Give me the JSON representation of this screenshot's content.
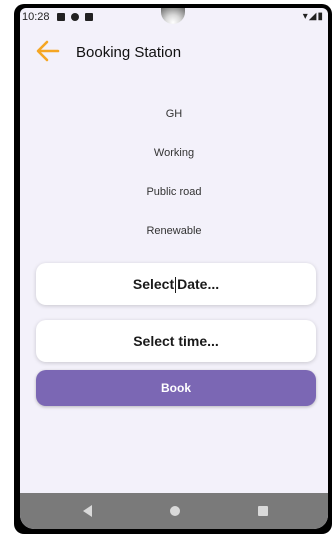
{
  "status_bar": {
    "time": "10:28",
    "right_icons": "▾◢▮"
  },
  "app_bar": {
    "title": "Booking Station",
    "back_icon": "arrow-left-icon",
    "accent_color": "#f5a623"
  },
  "station_info": {
    "name": "GH",
    "status": "Working",
    "access": "Public road",
    "energy": "Renewable"
  },
  "date_selector": {
    "label_part1": "Select",
    "label_part2": "Date..."
  },
  "time_selector": {
    "label": "Select time..."
  },
  "book_button": {
    "label": "Book",
    "color": "#7b67b4"
  },
  "nav_bar": {
    "back_icon": "triangle-back-icon",
    "home_icon": "circle-home-icon",
    "recents_icon": "square-recents-icon"
  }
}
